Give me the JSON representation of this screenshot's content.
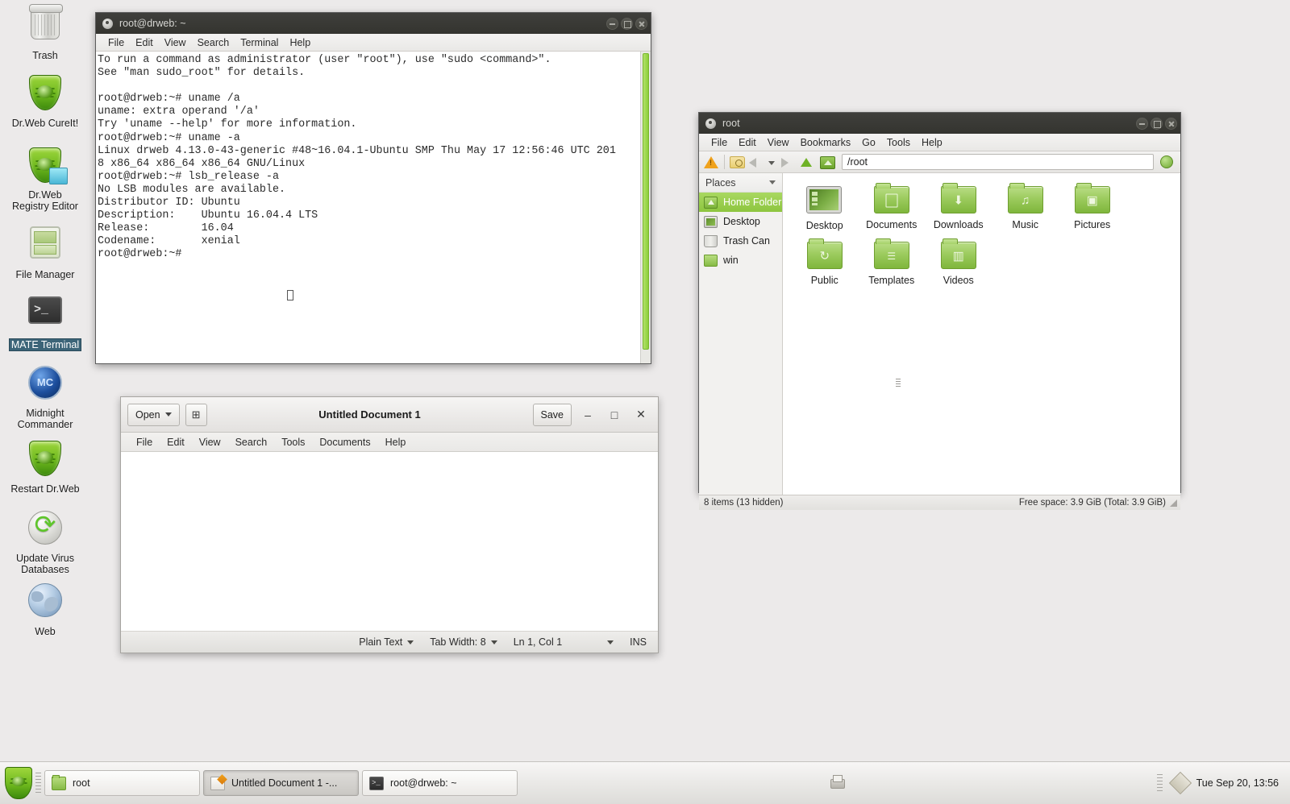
{
  "desktop": {
    "icons": [
      {
        "name": "Trash",
        "label": "Trash",
        "icon": "trash-icon",
        "selected": false
      },
      {
        "name": "Dr.Web CureIt!",
        "label": "Dr.Web CureIt!",
        "icon": "drweb-shield-icon",
        "selected": false
      },
      {
        "name": "Dr.Web Registry Editor",
        "label": "Dr.Web\nRegistry Editor",
        "icon": "drweb-registry-icon",
        "selected": false
      },
      {
        "name": "File Manager",
        "label": "File Manager",
        "icon": "file-manager-icon",
        "selected": false
      },
      {
        "name": "MATE Terminal",
        "label": "MATE Terminal",
        "icon": "terminal-icon",
        "selected": true
      },
      {
        "name": "Midnight Commander",
        "label": "Midnight\nCommander",
        "icon": "midnight-commander-icon",
        "selected": false
      },
      {
        "name": "Restart Dr.Web",
        "label": "Restart Dr.Web",
        "icon": "drweb-shield-icon",
        "selected": false
      },
      {
        "name": "Update Virus Databases",
        "label": "Update Virus\nDatabases",
        "icon": "update-icon",
        "selected": false
      },
      {
        "name": "Web",
        "label": "Web",
        "icon": "globe-icon",
        "selected": false
      }
    ]
  },
  "terminal": {
    "title": "root@drweb: ~",
    "menus": [
      "File",
      "Edit",
      "View",
      "Search",
      "Terminal",
      "Help"
    ],
    "content": "To run a command as administrator (user \"root\"), use \"sudo <command>\".\nSee \"man sudo_root\" for details.\n\nroot@drweb:~# uname /a\nuname: extra operand '/a'\nTry 'uname --help' for more information.\nroot@drweb:~# uname -a\nLinux drweb 4.13.0-43-generic #48~16.04.1-Ubuntu SMP Thu May 17 12:56:46 UTC 201\n8 x86_64 x86_64 x86_64 GNU/Linux\nroot@drweb:~# lsb_release -a\nNo LSB modules are available.\nDistributor ID:\tUbuntu\nDescription:\tUbuntu 16.04.4 LTS\nRelease:\t16.04\nCodename:\txenial\nroot@drweb:~# ",
    "window_buttons": [
      "minimize",
      "maximize",
      "close"
    ]
  },
  "file_manager": {
    "title": "root",
    "menus": [
      "File",
      "Edit",
      "View",
      "Bookmarks",
      "Go",
      "Tools",
      "Help"
    ],
    "path_value": "/root",
    "sidebar": {
      "header": "Places",
      "items": [
        {
          "label": "Home Folder",
          "icon": "home-folder-icon",
          "active": true
        },
        {
          "label": "Desktop",
          "icon": "desktop-icon",
          "active": false
        },
        {
          "label": "Trash Can",
          "icon": "trash-can-icon",
          "active": false
        },
        {
          "label": "win",
          "icon": "folder-icon",
          "active": false
        }
      ]
    },
    "items": [
      {
        "label": "Desktop",
        "icon": "desktop-monitor-icon",
        "emblem": ""
      },
      {
        "label": "Documents",
        "icon": "folder-documents-icon",
        "emblem": "box"
      },
      {
        "label": "Downloads",
        "icon": "folder-downloads-icon",
        "emblem": "⬇"
      },
      {
        "label": "Music",
        "icon": "folder-music-icon",
        "emblem": "♫"
      },
      {
        "label": "Pictures",
        "icon": "folder-pictures-icon",
        "emblem": "▣"
      },
      {
        "label": "Public",
        "icon": "folder-public-icon",
        "emblem": "↻"
      },
      {
        "label": "Templates",
        "icon": "folder-templates-icon",
        "emblem": "☰"
      },
      {
        "label": "Videos",
        "icon": "folder-videos-icon",
        "emblem": "▥"
      }
    ],
    "status_left": "8 items (13 hidden)",
    "status_right": "Free space: 3.9 GiB (Total: 3.9 GiB)"
  },
  "editor": {
    "title": "Untitled Document 1",
    "open_label": "Open",
    "save_label": "Save",
    "menus": [
      "File",
      "Edit",
      "View",
      "Search",
      "Tools",
      "Documents",
      "Help"
    ],
    "document_text": "",
    "status": {
      "language": "Plain Text",
      "tab_width": "Tab Width: 8",
      "position": "Ln 1, Col 1",
      "mode": "INS"
    },
    "window_buttons": {
      "minimize": "–",
      "maximize": "□",
      "close": "✕"
    }
  },
  "taskbar": {
    "tasks": [
      {
        "label": "root",
        "icon": "folder-icon",
        "active": false
      },
      {
        "label": "Untitled Document 1 -...",
        "icon": "text-editor-icon",
        "active": true
      },
      {
        "label": "root@drweb: ~",
        "icon": "terminal-icon",
        "active": false
      }
    ],
    "clock": "Tue Sep 20, 13:56"
  },
  "colors": {
    "desktop_bg": "#eceaea",
    "accent_green": "#8dc53f",
    "titlebar_dark": "#3a3a36",
    "scrollbar_green": "#9ed64a"
  }
}
